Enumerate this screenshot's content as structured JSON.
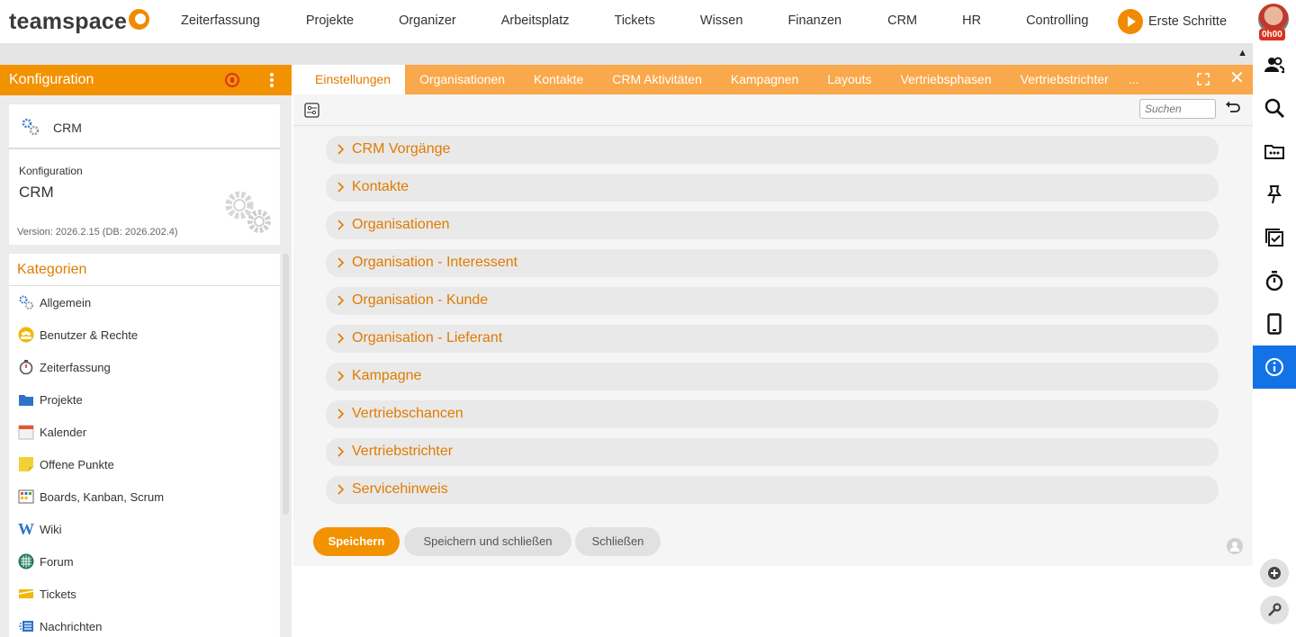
{
  "app": {
    "logo_text": "teamspace",
    "nav": [
      "Zeiterfassung",
      "Projekte",
      "Organizer",
      "Arbeitsplatz",
      "Tickets",
      "Wissen",
      "Finanzen",
      "CRM",
      "HR",
      "Controlling"
    ],
    "start_label": "Erste Schritte",
    "timer": "0h00"
  },
  "panel": {
    "title": "Konfiguration",
    "crm_name": "CRM",
    "config_label": "Konfiguration",
    "config_value": "CRM",
    "version": "Version: 2026.2.15 (DB: 2026.202.4)",
    "categories_title": "Kategorien",
    "categories": [
      {
        "label": "Allgemein",
        "icon": "gears-icon"
      },
      {
        "label": "Benutzer & Rechte",
        "icon": "users-icon"
      },
      {
        "label": "Zeiterfassung",
        "icon": "stopwatch-icon"
      },
      {
        "label": "Projekte",
        "icon": "folder-icon"
      },
      {
        "label": "Kalender",
        "icon": "calendar-icon"
      },
      {
        "label": "Offene Punkte",
        "icon": "sticky-note-icon"
      },
      {
        "label": "Boards, Kanban, Scrum",
        "icon": "board-icon"
      },
      {
        "label": "Wiki",
        "icon": "wiki-icon"
      },
      {
        "label": "Forum",
        "icon": "forum-icon"
      },
      {
        "label": "Tickets",
        "icon": "ticket-icon"
      },
      {
        "label": "Nachrichten",
        "icon": "messages-icon"
      }
    ]
  },
  "tabs": [
    "Einstellungen",
    "Organisationen",
    "Kontakte",
    "CRM Aktivitäten",
    "Kampagnen",
    "Layouts",
    "Vertriebsphasen",
    "Vertriebstrichter",
    "..."
  ],
  "toolbar": {
    "search_placeholder": "Suchen"
  },
  "sections": [
    "CRM Vorgänge",
    "Kontakte",
    "Organisationen",
    "Organisation - Interessent",
    "Organisation - Kunde",
    "Organisation - Lieferant",
    "Kampagne",
    "Vertriebschancen",
    "Vertriebstrichter",
    "Servicehinweis"
  ],
  "footer": {
    "save": "Speichern",
    "save_close": "Speichern und schließen",
    "close": "Schließen"
  },
  "colors": {
    "accent": "#f39200",
    "tab_bar": "#f9a84b",
    "section_text": "#e07b00",
    "active_sidebar": "#1373e6"
  }
}
